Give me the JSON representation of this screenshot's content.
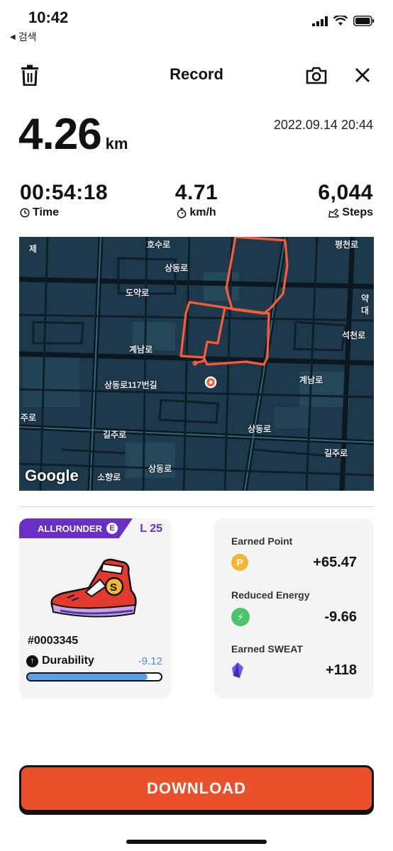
{
  "status": {
    "time": "10:42",
    "back_label": "검색"
  },
  "header": {
    "title": "Record",
    "icons": [
      "trash-icon",
      "camera-icon",
      "close-icon"
    ]
  },
  "summary": {
    "distance": "4.26",
    "distance_unit": "km",
    "datetime": "2022.09.14 20:44"
  },
  "stats": [
    {
      "value": "00:54:18",
      "label": "Time",
      "icon": "clock-icon"
    },
    {
      "value": "4.71",
      "label": "km/h",
      "icon": "stopwatch-icon"
    },
    {
      "value": "6,044",
      "label": "Steps",
      "icon": "shoe-icon"
    }
  ],
  "map": {
    "labels": [
      "호수로",
      "도약로",
      "계남로",
      "상동로117번길",
      "길주로",
      "소향로",
      "계남로",
      "길주로",
      "석천로",
      "평천로",
      "주로",
      "상동로",
      "상동로",
      "상동로",
      "약대",
      "제",
      "Google"
    ],
    "google": "Google"
  },
  "sneaker": {
    "class": "ALLROUNDER",
    "class_grade": "E",
    "level": "L 25",
    "id": "#0003345",
    "durability_label": "Durability",
    "durability_change": "-9.12",
    "durability_level": 0.9
  },
  "earnings": [
    {
      "label": "Earned Point",
      "value": "+65.47",
      "icon": "point-coin-icon"
    },
    {
      "label": "Reduced Energy",
      "value": "-9.66",
      "icon": "energy-icon"
    },
    {
      "label": "Earned SWEAT",
      "value": "+118",
      "icon": "sweat-crystal-icon"
    }
  ],
  "download": {
    "label": "DOWNLOAD"
  },
  "colors": {
    "accent": "#e8512a",
    "purple": "#6a2fc4",
    "map_bg": "#1d3a4d",
    "route": "#ff5a36"
  }
}
